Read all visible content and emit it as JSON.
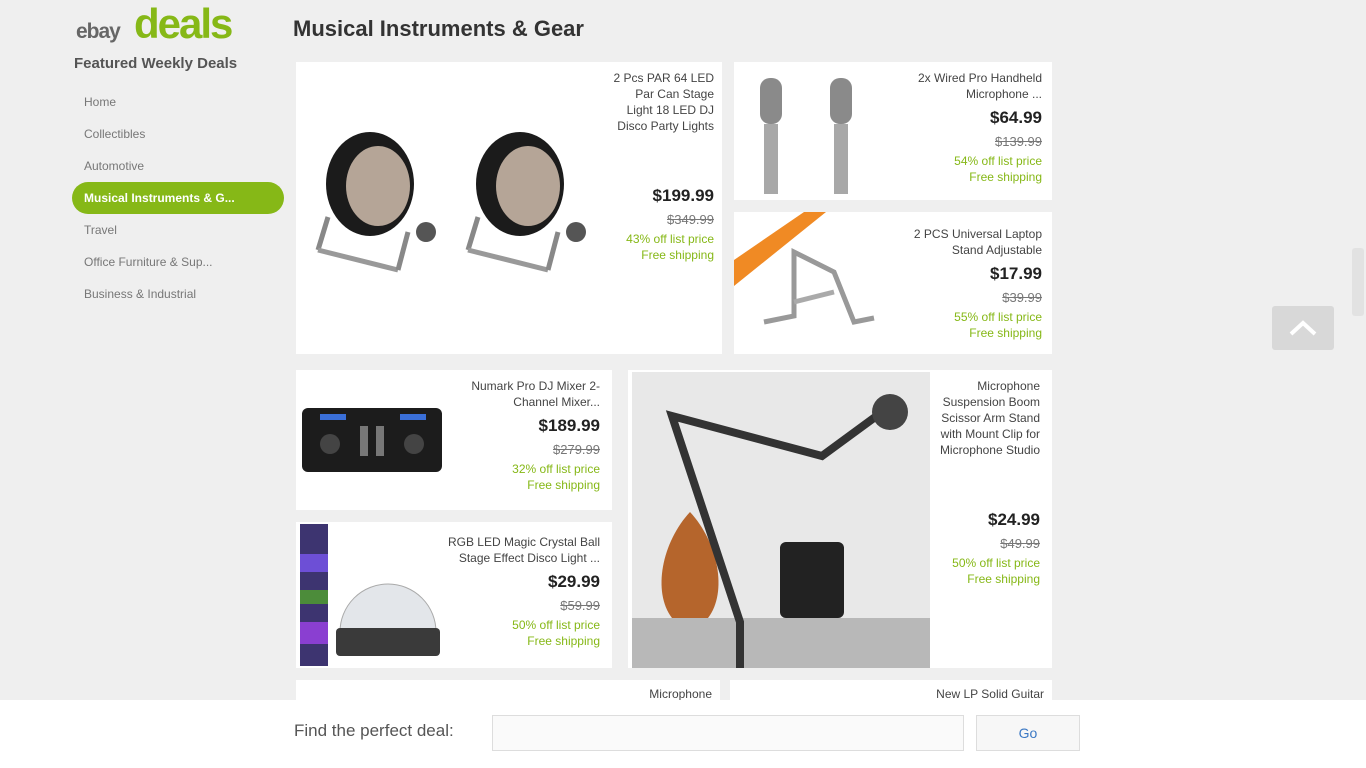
{
  "logo": {
    "ebay": "ebay",
    "deals": "deals"
  },
  "sidebar": {
    "heading": "Featured Weekly Deals",
    "items": [
      {
        "label": "Home"
      },
      {
        "label": "Collectibles"
      },
      {
        "label": "Automotive"
      },
      {
        "label": "Musical Instruments & G..."
      },
      {
        "label": "Travel"
      },
      {
        "label": "Office Furniture & Sup..."
      },
      {
        "label": "Business & Industrial"
      }
    ],
    "active_index": 3
  },
  "page": {
    "title": "Musical Instruments & Gear"
  },
  "cards": [
    {
      "title": "2 Pcs PAR 64 LED Par Can Stage Light 18 LED DJ Disco Party Lights",
      "price": "$199.99",
      "orig": "$349.99",
      "off": "43% off list price",
      "ship": "Free shipping"
    },
    {
      "title": "2x Wired Pro Handheld Microphone ...",
      "price": "$64.99",
      "orig": "$139.99",
      "off": "54% off list price",
      "ship": "Free shipping"
    },
    {
      "title": "2 PCS Universal Laptop Stand Adjustable",
      "price": "$17.99",
      "orig": "$39.99",
      "off": "55% off list price",
      "ship": "Free shipping"
    },
    {
      "title": "Numark Pro DJ Mixer 2-Channel Mixer...",
      "price": "$189.99",
      "orig": "$279.99",
      "off": "32% off list price",
      "ship": "Free shipping"
    },
    {
      "title": "Microphone Suspension Boom Scissor Arm Stand with Mount Clip for Microphone Studio",
      "price": "$24.99",
      "orig": "$49.99",
      "off": "50% off list price",
      "ship": "Free shipping"
    },
    {
      "title": "RGB LED Magic Crystal Ball Stage Effect Disco Light ...",
      "price": "$29.99",
      "orig": "$59.99",
      "off": "50% off list price",
      "ship": "Free shipping"
    },
    {
      "title": "Microphone",
      "partial": true
    },
    {
      "title": "New LP Solid Guitar",
      "partial": true
    }
  ],
  "footer": {
    "label": "Find the perfect deal:",
    "search_placeholder": "",
    "go_label": "Go"
  },
  "icons": {
    "back_to_top": "chevron-up-icon"
  },
  "colors": {
    "accent": "#86b817",
    "link": "#3b78c4",
    "background": "#efefef"
  }
}
